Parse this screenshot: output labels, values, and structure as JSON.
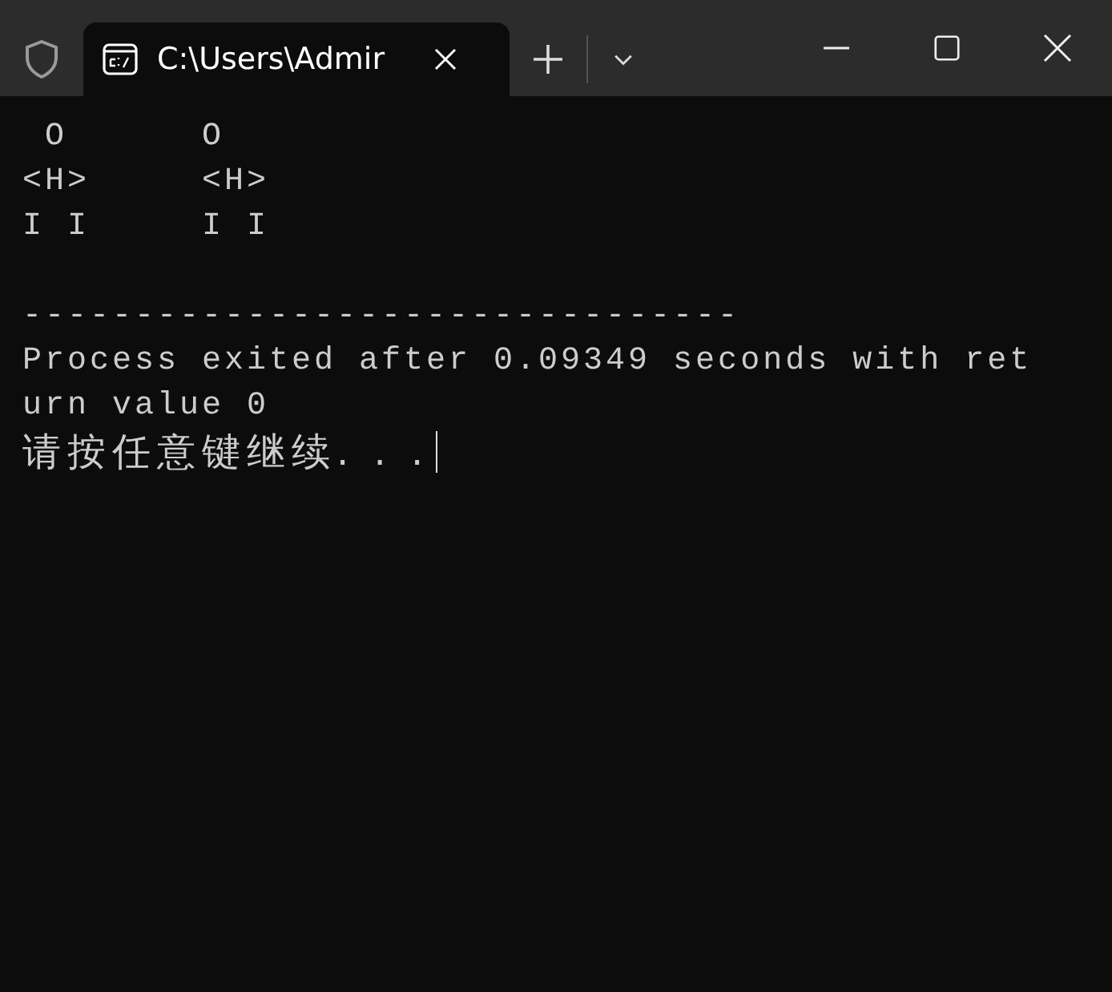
{
  "tab": {
    "title": "C:\\Users\\Admir",
    "selected": true
  },
  "lines": [
    {
      "text": " O      O",
      "gap_before": false
    },
    {
      "text": "<H>     <H>",
      "gap_before": false
    },
    {
      "text": "I I     I I",
      "gap_before": false
    },
    {
      "text": "--------------------------------",
      "gap_before": true
    },
    {
      "text": "Process exited after 0.09349 seconds with ret",
      "gap_before": false
    },
    {
      "text": "urn value 0",
      "gap_before": false
    }
  ],
  "prompt": {
    "text": "请按任意键继续. . .",
    "cursor": true
  }
}
